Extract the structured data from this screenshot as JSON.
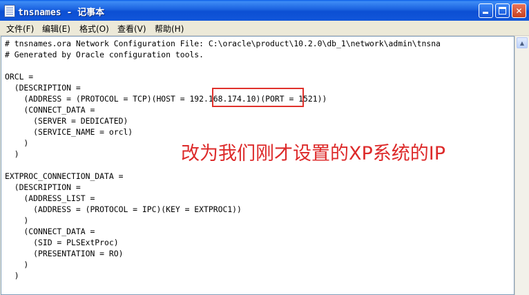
{
  "window": {
    "title": "tnsnames - 记事本",
    "controls": {
      "minimize": "minimize",
      "maximize": "maximize",
      "close": "✕"
    }
  },
  "menu": [
    "文件(F)",
    "编辑(E)",
    "格式(O)",
    "查看(V)",
    "帮助(H)"
  ],
  "editor": {
    "content": "# tnsnames.ora Network Configuration File: C:\\oracle\\product\\10.2.0\\db_1\\network\\admin\\tnsna\n# Generated by Oracle configuration tools.\n\nORCL =\n  (DESCRIPTION =\n    (ADDRESS = (PROTOCOL = TCP)(HOST = 192.168.174.10)(PORT = 1521))\n    (CONNECT_DATA =\n      (SERVER = DEDICATED)\n      (SERVICE_NAME = orcl)\n    )\n  )\n\nEXTPROC_CONNECTION_DATA =\n  (DESCRIPTION =\n    (ADDRESS_LIST =\n      (ADDRESS = (PROTOCOL = IPC)(KEY = EXTPROC1))\n    )\n    (CONNECT_DATA =\n      (SID = PLSExtProc)\n      (PRESENTATION = RO)\n    )\n  )"
  },
  "annotation": {
    "text": "改为我们刚才设置的XP系统的IP",
    "highlighted_value": "192.168.174.10",
    "color": "#dd2a2a"
  },
  "colors": {
    "titlebar": "#0c4fd3",
    "menubar": "#ece9d8",
    "highlight": "#e0312b"
  }
}
